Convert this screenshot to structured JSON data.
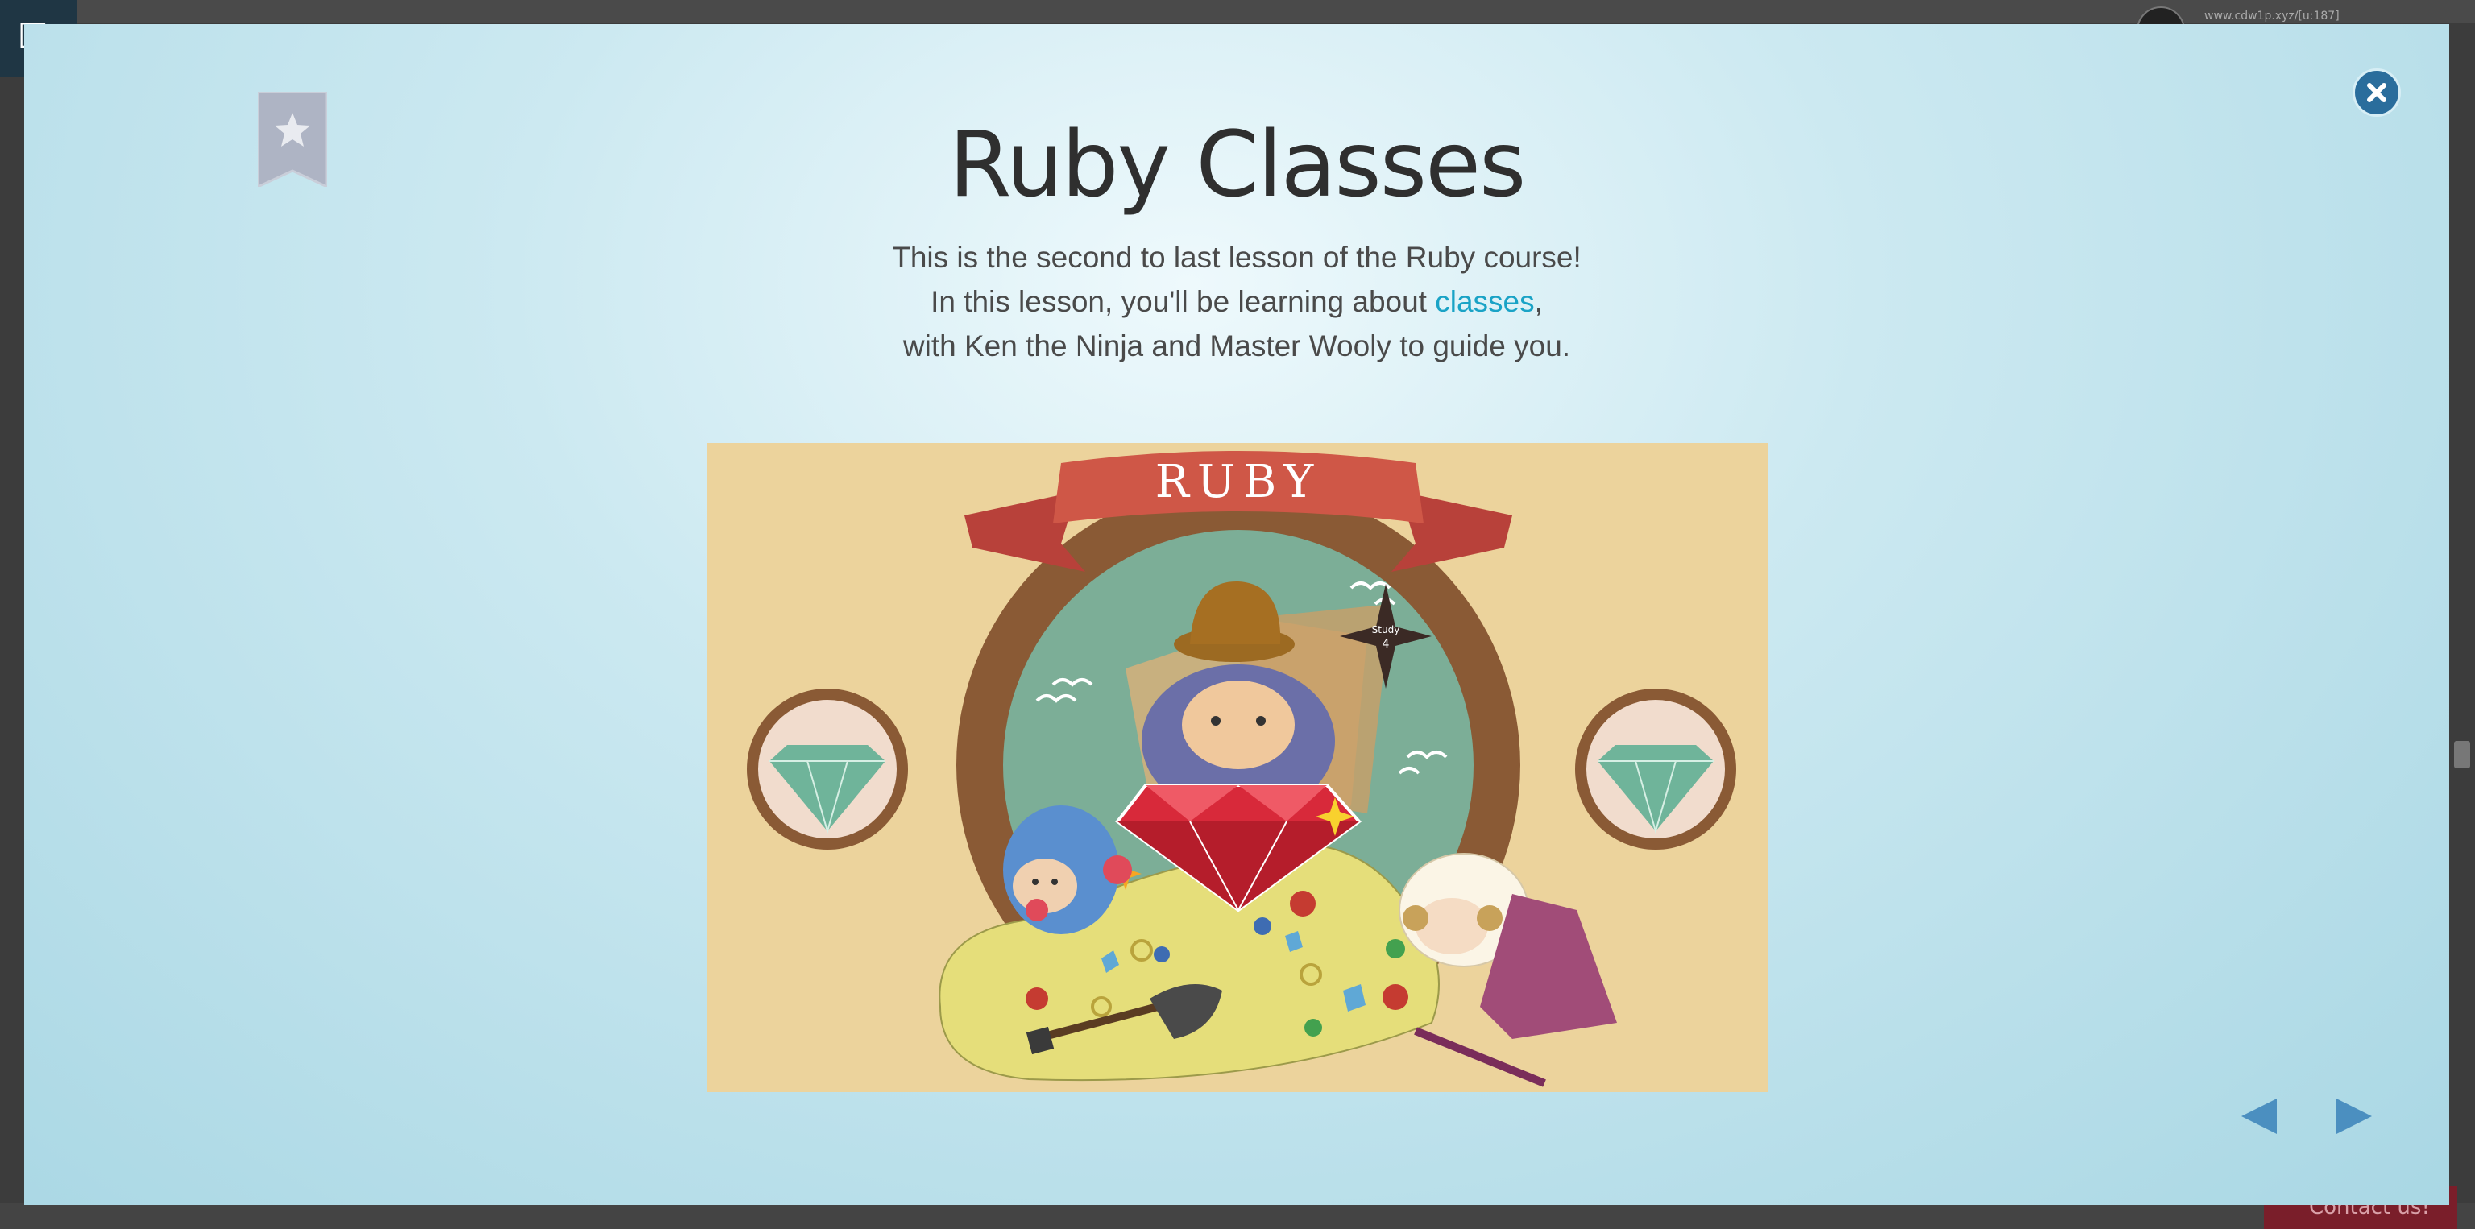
{
  "background": {
    "url_text": "www.cdw1p.xyz/[u:187]",
    "contact_label": "Contact us!"
  },
  "lesson": {
    "title": "Ruby Classes",
    "line1": "This is the second to last lesson of the Ruby course!",
    "line2_prefix": "In this lesson, you'll be learning about ",
    "line2_link": "classes",
    "line2_suffix": ",",
    "line3": "with Ken the Ninja and Master Wooly to guide you."
  },
  "illustration": {
    "banner_text": "RUBY",
    "star_text_1": "Study",
    "star_text_2": "4"
  },
  "icons": {
    "bookmark": "bookmark-star-icon",
    "close": "close-icon",
    "prev": "arrow-left-icon",
    "next": "arrow-right-icon"
  },
  "colors": {
    "accent_link": "#1aa3c6",
    "close_button": "#2a6d9c",
    "nav_arrow": "#4b8fc0",
    "art_background": "#ecd39c",
    "ruby_red": "#d8293a"
  }
}
